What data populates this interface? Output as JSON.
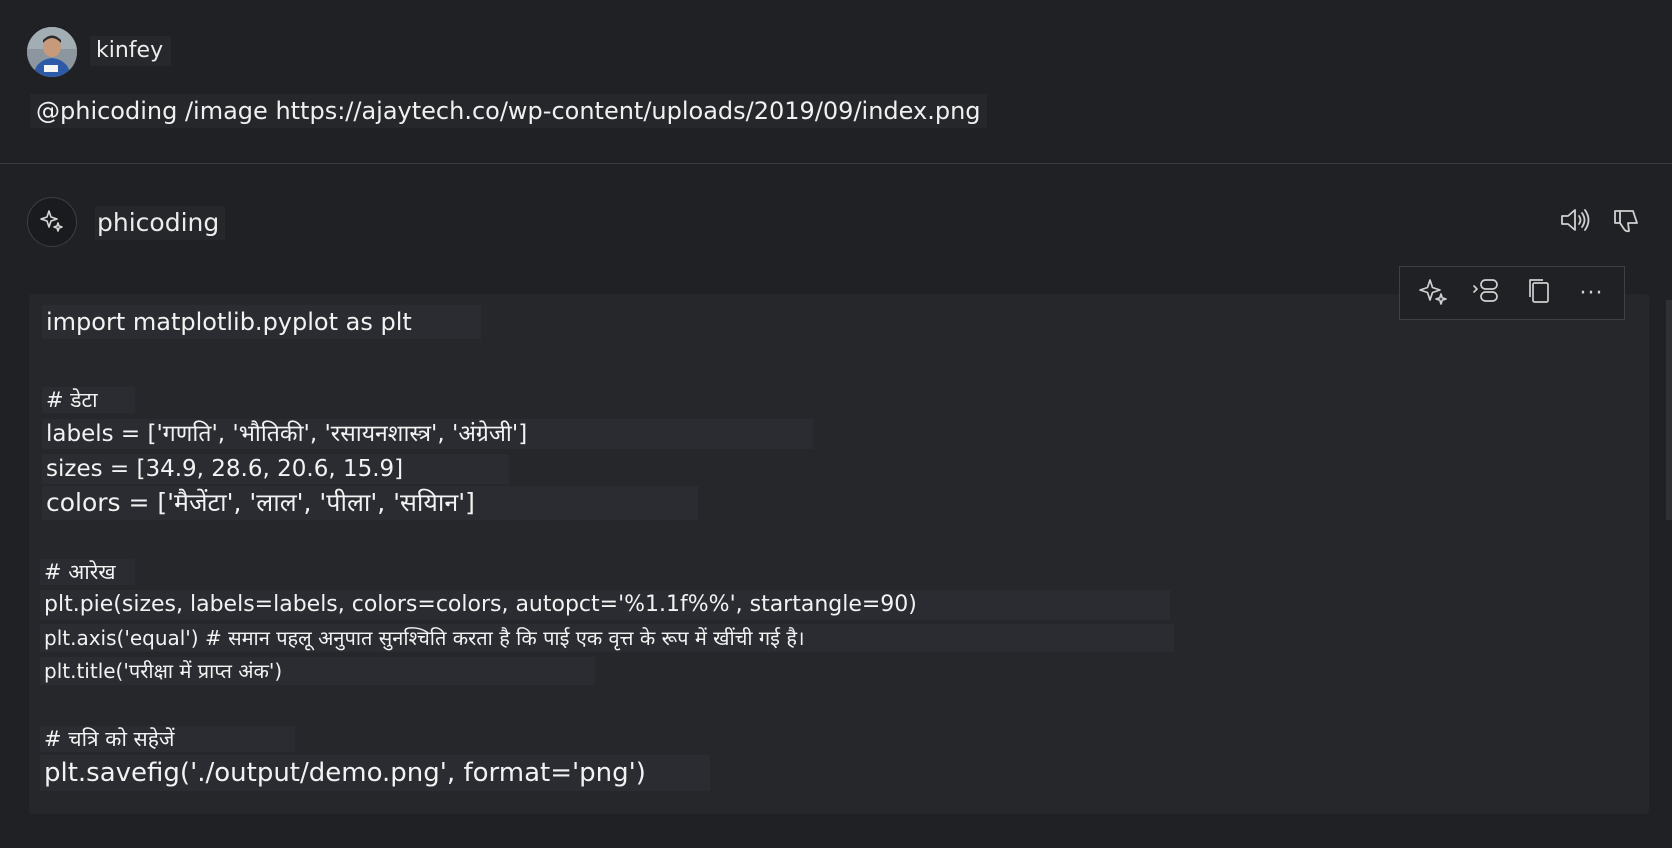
{
  "user": {
    "name": "kinfey",
    "message": "@phicoding /image https://ajaytech.co/wp-content/uploads/2019/09/index.png"
  },
  "assistant": {
    "name": "phicoding",
    "icons": {
      "avatar": "sparkle-icon",
      "speak": "speaker-icon",
      "dislike": "thumbs-down-icon"
    }
  },
  "code_toolbar": {
    "icons": [
      "sparkle-icon",
      "insert-into-terminal-icon",
      "copy-icon",
      "more-icon"
    ],
    "more_label": "···"
  },
  "code": {
    "lines": [
      "import matplotlib.pyplot as plt",
      "# डेटा",
      "labels = ['गणति', 'भौतिकी', 'रसायनशास्त्र', 'अंग्रेजी']",
      "sizes = [34.9, 28.6, 20.6, 15.9]",
      "colors = ['मैजेंटा', 'लाल', 'पीला', 'सयिान']",
      "# आरेख",
      "plt.pie(sizes, labels=labels, colors=colors, autopct='%1.1f%%', startangle=90)",
      "plt.axis('equal') # समान पहलू अनुपात सुनश्चिति करता है कि पाई एक वृत्त के रूप में खींची गई है।",
      "plt.title('परीक्षा में प्राप्त अंक')",
      "# चत्रि को सहेजें",
      "plt.savefig('./output/demo.png', format='png')"
    ]
  },
  "colors": {
    "background": "#1f2125",
    "card": "#25272b",
    "text": "#f2f2f2"
  }
}
